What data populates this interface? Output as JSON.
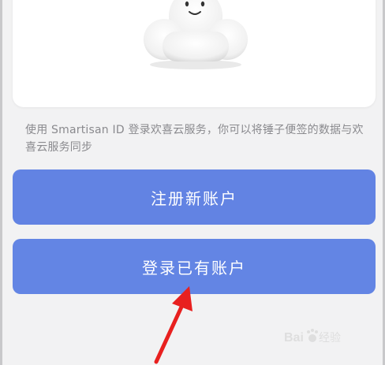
{
  "description": "使用 Smartisan ID 登录欢喜云服务，你可以将锤子便签的数据与欢喜云服务同步",
  "buttons": {
    "register_label": "注册新账户",
    "login_label": "登录已有账户"
  },
  "colors": {
    "background": "#f2f2f3",
    "card": "#ffffff",
    "button_primary": "#6283e3",
    "annotation_arrow": "#e8201f",
    "description_text": "#8a8a8e"
  },
  "icons": {
    "mascot": "smiling-cloud-icon",
    "annotation": "red-arrow-icon"
  },
  "watermark": {
    "brand": "Baidu",
    "suffix": "经验"
  }
}
